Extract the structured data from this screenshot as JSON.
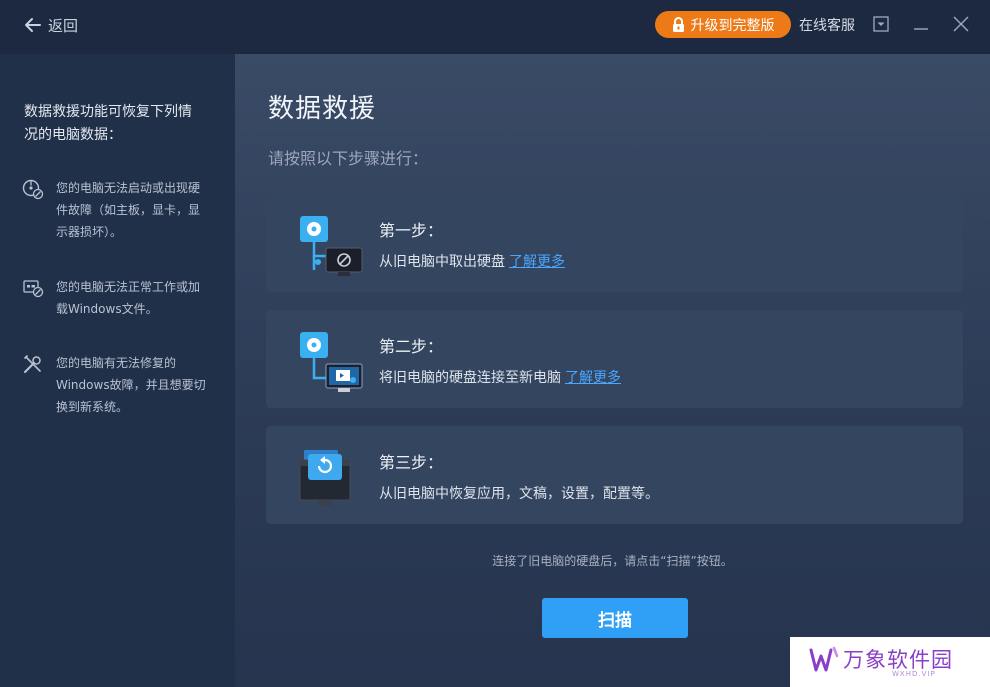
{
  "titlebar": {
    "back_label": "返回",
    "upgrade_label": "升级到完整版",
    "support_label": "在线客服"
  },
  "sidebar": {
    "intro": "数据救援功能可恢复下列情况的电脑数据：",
    "items": [
      {
        "icon": "disk-broken-icon",
        "text": "您的电脑无法启动或出现硬件故障（如主板，显卡，显示器损坏）。"
      },
      {
        "icon": "windows-error-icon",
        "text": "您的电脑无法正常工作或加载Windows文件。"
      },
      {
        "icon": "tools-icon",
        "text": "您的电脑有无法修复的Windows故障，并且想要切换到新系统。"
      }
    ]
  },
  "main": {
    "title": "数据救援",
    "subtitle": "请按照以下步骤进行：",
    "steps": [
      {
        "title": "第一步：",
        "desc": "从旧电脑中取出硬盘",
        "link": "了解更多",
        "icon": "remove-disk-icon"
      },
      {
        "title": "第二步：",
        "desc": "将旧电脑的硬盘连接至新电脑",
        "link": "了解更多",
        "icon": "connect-disk-icon"
      },
      {
        "title": "第三步：",
        "desc": "从旧电脑中恢复应用，文稿，设置，配置等。",
        "link": "",
        "icon": "restore-icon"
      }
    ],
    "hint": "连接了旧电脑的硬盘后，请点击“扫描”按钮。",
    "scan_label": "扫描"
  },
  "watermark": {
    "name": "万象软件园",
    "url": "WXHD.VIP"
  },
  "colors": {
    "accent": "#2fa0f5",
    "upgrade": "#ee7a17",
    "link": "#4aa6ff"
  }
}
